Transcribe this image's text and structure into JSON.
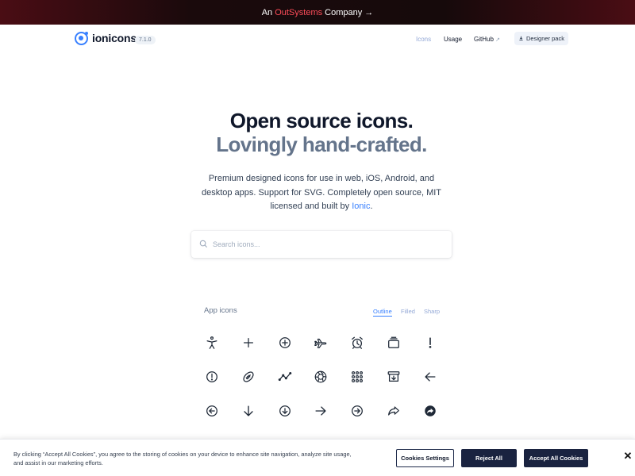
{
  "banner": {
    "prefix": "An ",
    "brand": "OutSystems",
    "suffix": " Company →"
  },
  "header": {
    "logo_text": "ionicons",
    "version": "7.1.0",
    "nav": [
      {
        "label": "Icons",
        "active": true
      },
      {
        "label": "Usage",
        "active": false
      },
      {
        "label": "GitHub",
        "external": true
      }
    ],
    "designer_pack": "Designer pack",
    "accent_color": "#3880ff"
  },
  "hero": {
    "title_line1": "Open source icons.",
    "title_line2": "Lovingly hand-crafted.",
    "desc_part1": "Premium designed icons for use in web, iOS, Android, and desktop apps. Support for SVG. Completely open source, MIT licensed and built by ",
    "desc_link": "Ionic",
    "desc_end": "."
  },
  "search": {
    "placeholder": "Search icons..."
  },
  "icons_section": {
    "title": "App icons",
    "tabs": [
      {
        "label": "Outline",
        "active": true
      },
      {
        "label": "Filled",
        "active": false
      },
      {
        "label": "Sharp",
        "active": false
      }
    ],
    "rows": [
      [
        "accessibility-icon",
        "add-icon",
        "add-circle-icon",
        "airplane-icon",
        "alarm-icon",
        "albums-icon",
        "alert-icon"
      ],
      [
        "alert-circle-icon",
        "american-football-icon",
        "analytics-icon",
        "aperture-icon",
        "apps-icon",
        "archive-icon",
        "arrow-back-icon"
      ],
      [
        "arrow-back-circle-icon",
        "arrow-down-icon",
        "arrow-down-circle-icon",
        "arrow-forward-icon",
        "arrow-forward-circle-icon",
        "arrow-redo-icon",
        "arrow-redo-circle-icon"
      ]
    ]
  },
  "cookie": {
    "text": "By clicking “Accept All Cookies”, you agree to the storing of cookies on your device to enhance site navigation, analyze site usage, and assist in our marketing efforts.",
    "settings_label": "Cookies Settings",
    "reject_label": "Reject All",
    "accept_label": "Accept All Cookies",
    "close_label": "✕"
  }
}
